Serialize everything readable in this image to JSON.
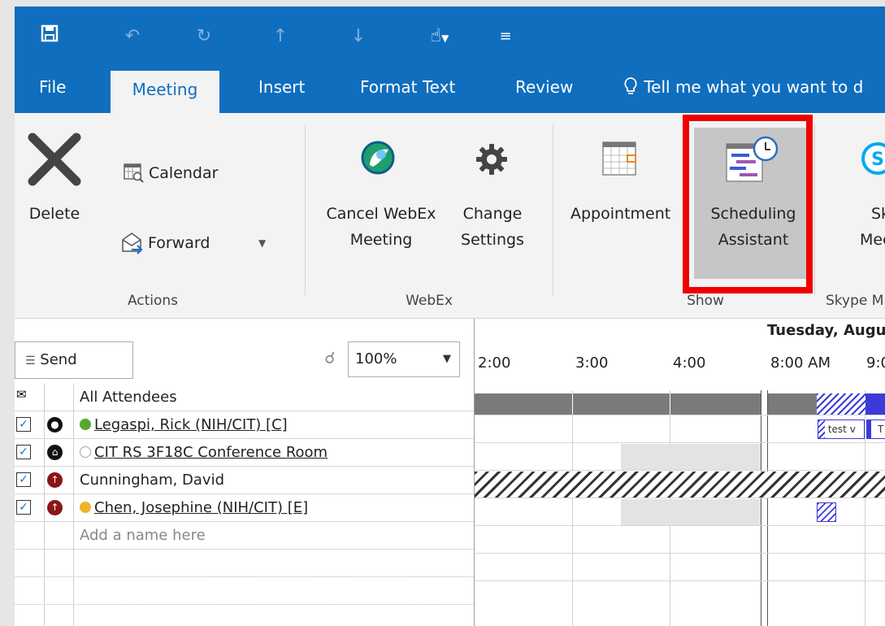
{
  "qat": {
    "icons": [
      "save-icon",
      "undo-icon",
      "redo-icon",
      "up-arrow-icon",
      "down-arrow-icon",
      "touch-mode-icon",
      "customize-icon"
    ]
  },
  "tabs": [
    {
      "label": "File"
    },
    {
      "label": "Meeting",
      "active": true
    },
    {
      "label": "Insert"
    },
    {
      "label": "Format Text"
    },
    {
      "label": "Review"
    }
  ],
  "tell_me": "Tell me what you want to d",
  "ribbon": {
    "actions": {
      "delete": "Delete",
      "calendar": "Calendar",
      "forward": "Forward",
      "group": "Actions"
    },
    "webex": {
      "cancel_line1": "Cancel WebEx",
      "cancel_line2": "Meeting",
      "change_line1": "Change",
      "change_line2": "Settings",
      "group": "WebEx"
    },
    "show": {
      "appointment": "Appointment",
      "sched_line1": "Scheduling",
      "sched_line2": "Assistant",
      "group": "Show"
    },
    "skype": {
      "line1": "Sky",
      "line2": "Mee",
      "group": "Skype M"
    }
  },
  "toolbar": {
    "send": "Send",
    "zoom": "100%"
  },
  "attendees": {
    "header": "All Attendees",
    "rows": [
      {
        "name": "Legaspi, Rick (NIH/CIT) [C]",
        "checked": true,
        "role_color": "#111111",
        "status_color": "#57a831"
      },
      {
        "name": "CIT RS 3F18C Conference Room",
        "checked": true,
        "role_color": "#111111",
        "status_color": "#ffffff"
      },
      {
        "name": "Cunningham, David",
        "checked": true,
        "role_color": "#8b1515",
        "status_color": ""
      },
      {
        "name": "Chen, Josephine (NIH/CIT) [E]",
        "checked": true,
        "role_color": "#8b1515",
        "status_color": "#f0b428"
      }
    ],
    "add_placeholder": "Add a name here"
  },
  "schedule": {
    "date": "Tuesday, Augu",
    "times": [
      "2:00",
      "3:00",
      "4:00",
      "8:00 AM",
      "9:0"
    ],
    "event_label_1": "test v",
    "event_label_2": "T"
  },
  "colors": {
    "accent": "#106ebe",
    "highlight": "#ee0000",
    "busy": "#7a7a7a",
    "tentative": "#3b3bd9"
  }
}
